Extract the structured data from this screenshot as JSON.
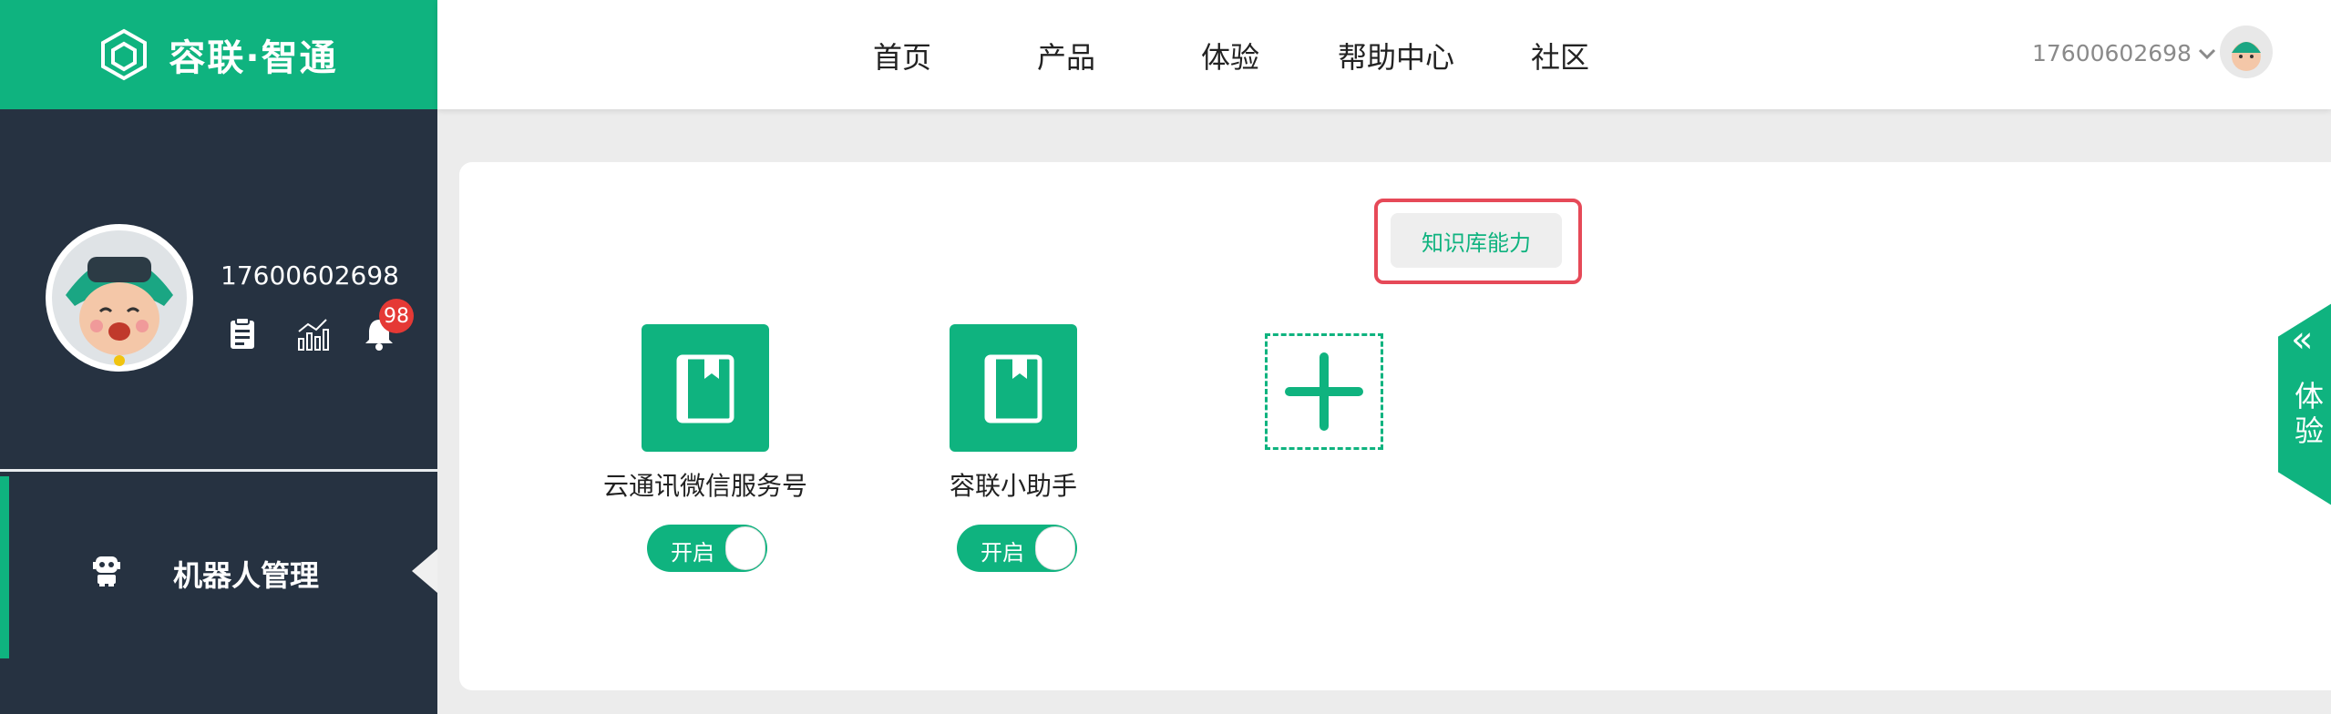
{
  "brand": {
    "name": "容联·智通"
  },
  "nav": {
    "items": [
      {
        "label": "首页"
      },
      {
        "label": "产品"
      },
      {
        "label": "体验"
      },
      {
        "label": "帮助中心"
      },
      {
        "label": "社区"
      }
    ]
  },
  "user": {
    "phone": "17600602698"
  },
  "sidebar": {
    "profile_phone": "17600602698",
    "notification_count": "98",
    "menu_active_label": "机器人管理"
  },
  "main": {
    "knowledge_button_label": "知识库能力",
    "bots": [
      {
        "name": "云通讯微信服务号",
        "toggle_label": "开启",
        "enabled": true
      },
      {
        "name": "容联小助手",
        "toggle_label": "开启",
        "enabled": true
      }
    ]
  },
  "side_tab": {
    "label": "体验"
  },
  "colors": {
    "accent": "#0fb37f",
    "sidebar_bg": "#263241",
    "highlight_border": "#e64958",
    "badge": "#e53935"
  }
}
